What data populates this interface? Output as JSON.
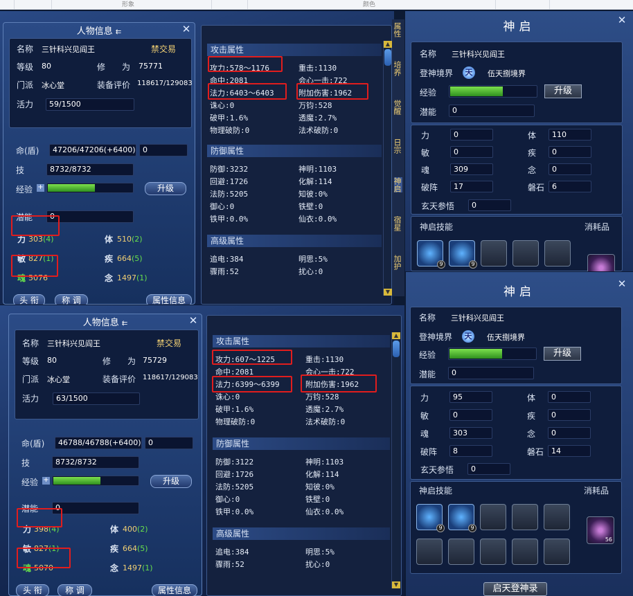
{
  "top_strip": {
    "left": "形象",
    "center": "颜色"
  },
  "char": {
    "title": "人物信息",
    "fields": {
      "name_label": "名称",
      "level_label": "等级",
      "sect_label": "门派",
      "vigor_label": "活力",
      "hp_label": "命(盾)",
      "skill_label": "技",
      "exp_label": "经验",
      "potential_label": "潜能",
      "cult_label": "修　　为",
      "equip_label": "装备评价"
    },
    "no_trade": "禁交易",
    "name": "三针科兴见阎王",
    "sect": "冰心堂",
    "level": "80",
    "buttons": {
      "head": "头 衔",
      "title": "称 调",
      "attrinfo": "属性信息",
      "upgrade": "升级"
    },
    "stats_labels": {
      "str": "力",
      "con": "体",
      "agi": "敏",
      "spd": "疾",
      "soul": "魂",
      "mind": "念"
    },
    "top": {
      "cultivation": "75771",
      "equip_score": "118617/129083",
      "vigor": "59/1500",
      "hp": "47206/47206(+6400)",
      "hp_extra": "0",
      "skill_pts": "8732/8732",
      "exp_fill": 0.55,
      "potential": "0",
      "str": "303",
      "str_b": "(4)",
      "con": "510",
      "con_b": "(2)",
      "agi": "827",
      "agi_b": "(1)",
      "spd": "664",
      "spd_b": "(5)",
      "soul": "5076",
      "soul_b": "",
      "mind": "1497",
      "mind_b": "(1)"
    },
    "bot": {
      "cultivation": "75729",
      "equip_score": "118617/129083",
      "vigor": "63/1500",
      "hp": "46788/46788(+6400)",
      "hp_extra": "0",
      "skill_pts": "8732/8732",
      "exp_fill": 0.55,
      "potential": "0",
      "str": "398",
      "str_b": "(4)",
      "con": "400",
      "con_b": "(2)",
      "agi": "827",
      "agi_b": "(1)",
      "spd": "664",
      "spd_b": "(5)",
      "soul": "5070",
      "soul_b": "",
      "mind": "1497",
      "mind_b": "(1)"
    }
  },
  "attr": {
    "sections": {
      "attack": "攻击属性",
      "defense": "防御属性",
      "advanced": "高级属性"
    },
    "top": {
      "atk": "攻力:578～1176",
      "hit": "命中:2081",
      "mag": "法力:6403～6403",
      "crit": "重击:1130",
      "heart": "会心一击:722",
      "extra": "附加伤害:1962",
      "zhu": "诛心:0",
      "pojia": "破甲:1.6%",
      "wuli": "物理破防:0",
      "fangqi": "万钧:528",
      "touma": "透魔:2.7%",
      "fashu": "法术破防:0",
      "def": "防御:3232",
      "dodge": "回避:1726",
      "mdef": "法防:5205",
      "yuxin": "御心:0",
      "tiejia": "铁甲:0.0%",
      "shen": "神明:1103",
      "huajie": "化解:114",
      "zhibi": "知彼:0%",
      "tiebi": "铁壁:0",
      "xianyi": "仙衣:0.0%",
      "zhui": "追电:384",
      "ming": "明思:5%",
      "zhou": "骤雨:52",
      "rao": "扰心:0"
    },
    "bot": {
      "atk": "攻力:607～1225",
      "hit": "命中:2081",
      "mag": "法力:6399～6399",
      "crit": "重击:1130",
      "heart": "会心一击:722",
      "extra": "附加伤害:1962",
      "zhu": "诛心:0",
      "pojia": "破甲:1.6%",
      "wuli": "物理破防:0",
      "fangqi": "万钧:528",
      "touma": "透魔:2.7%",
      "fashu": "法术破防:0",
      "def": "防御:3122",
      "dodge": "回避:1726",
      "mdef": "法防:5205",
      "yuxin": "御心:0",
      "tiejia": "铁甲:0.0%",
      "shen": "神明:1103",
      "huajie": "化解:114",
      "zhibi": "知彼:0%",
      "tiebi": "铁壁:0",
      "xianyi": "仙衣:0.0%",
      "zhui": "追电:384",
      "ming": "明思:5%",
      "zhou": "骤雨:52",
      "rao": "扰心:0"
    }
  },
  "shenqi": {
    "title": "神启",
    "labels": {
      "name": "名称",
      "realm": "登神境界",
      "exp": "经验",
      "potential": "潜能",
      "li": "力",
      "ti": "体",
      "min": "敏",
      "ji": "疾",
      "hun": "魂",
      "nian": "念",
      "pozhen": "破阵",
      "panshi": "磐石",
      "xuantian": "玄天参悟",
      "skills": "神启技能",
      "consume": "消耗品"
    },
    "name": "三针科兴见阎王",
    "tian_icon": "天",
    "realm": "伍天捌境界",
    "upgrade": "升级",
    "login_button": "启天登神录",
    "skill_badge": "9",
    "orb_count": "56",
    "top": {
      "exp_fill": 0.6,
      "potential": "0",
      "li": "0",
      "ti": "110",
      "min": "0",
      "ji": "0",
      "hun": "309",
      "nian": "0",
      "pozhen": "17",
      "panshi": "6",
      "xuantian": "0"
    },
    "bot": {
      "exp_fill": 0.6,
      "potential": "0",
      "li": "95",
      "ti": "0",
      "min": "0",
      "ji": "0",
      "hun": "303",
      "nian": "0",
      "pozhen": "8",
      "panshi": "14",
      "xuantian": "0"
    }
  },
  "side_tabs": {
    "t1": "属性",
    "t2": "培养",
    "t3": "觉醒",
    "t4": "日宗",
    "t5": "神启",
    "t6": "宿星",
    "t7": "加护"
  }
}
